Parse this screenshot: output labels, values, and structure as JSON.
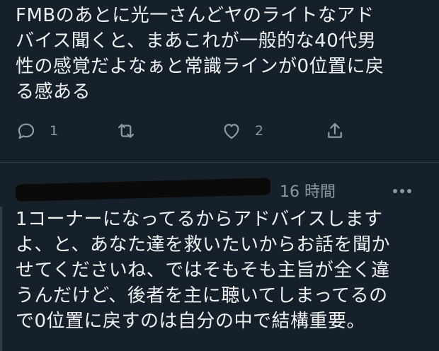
{
  "tweet1": {
    "lines": [
      "FMBのあとに光一さんどヤのライトなアド",
      "バイス聞くと、まあこれが一般的な40代男",
      "性の感覚だよなぁと常識ラインが0位置に戻",
      "る感ある"
    ],
    "reply_count": "1",
    "like_count": "2"
  },
  "reply": {
    "time": "16 時間",
    "lines": [
      "1コーナーになってるからアドバイスします",
      "よ、と、あなた達を救いたいからお話を聞か",
      "せてくださいね、ではそもそも主旨が全く違",
      "うんだけど、後者を主に聴いてしまってるの",
      "で0位置に戻すのは自分の中で結構重要。"
    ]
  },
  "icons": [
    "reply-icon",
    "retweet-icon",
    "like-icon",
    "share-icon",
    "more-icon"
  ]
}
